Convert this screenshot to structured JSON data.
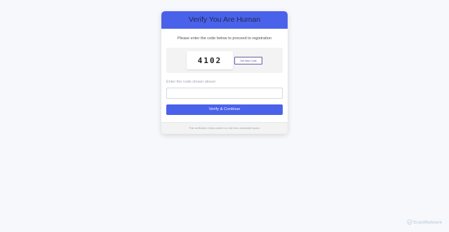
{
  "header": {
    "title": "Verify You Are Human"
  },
  "body": {
    "instruction": "Please enter the code below to proceed to registration",
    "captcha": {
      "code": "4102",
      "new_code_label": "Get New Code"
    },
    "field": {
      "label": "Enter the code shown above:",
      "value": "",
      "placeholder": ""
    },
    "submit_label": "Verify & Continue"
  },
  "footer": {
    "note": "This verification helps protect our site from automated spam."
  },
  "watermark": {
    "text": "ScanMalware",
    "icon": "shield-icon"
  },
  "colors": {
    "accent": "#4a62ea",
    "background": "#f7f8fb",
    "watermark": "#c8d4e6"
  }
}
